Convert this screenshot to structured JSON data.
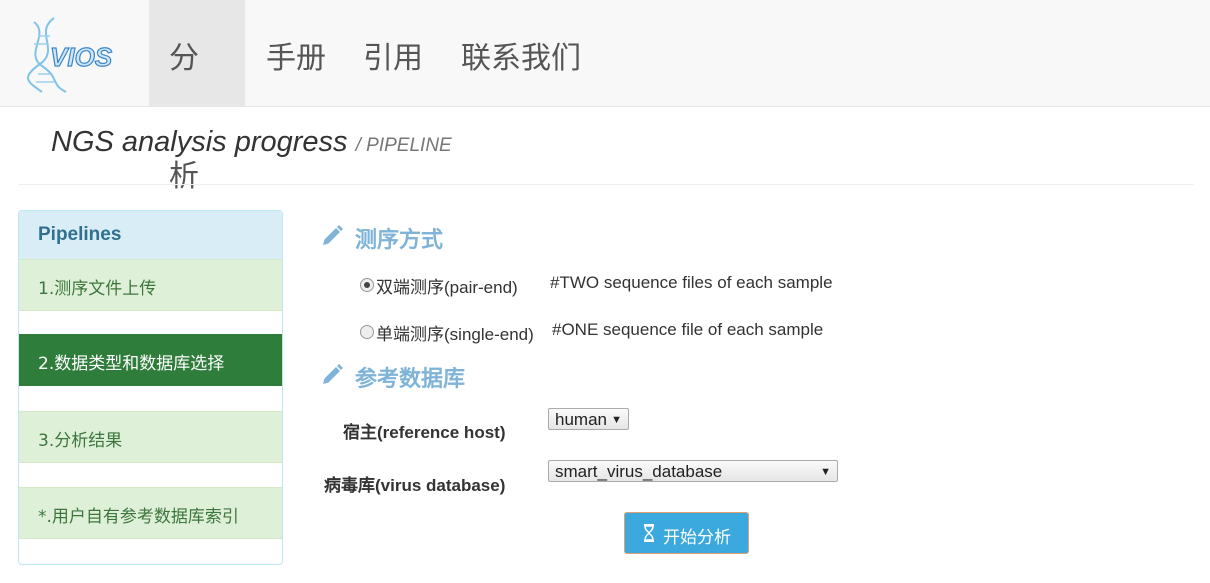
{
  "brand": {
    "logo_text": "VIOS"
  },
  "nav": {
    "items": [
      "分析",
      "手册",
      "引用",
      "联系我们"
    ]
  },
  "header": {
    "title": "NGS analysis progress",
    "subtitle": "/ PIPELINE"
  },
  "sidebar": {
    "heading": "Pipelines",
    "items": [
      {
        "label": "1.测序文件上传",
        "active": false
      },
      {
        "label": "2.数据类型和数据库选择",
        "active": true
      },
      {
        "label": "3.分析结果",
        "active": false
      },
      {
        "label": "*.用户自有参考数据库索引",
        "active": false
      }
    ]
  },
  "sequencing": {
    "title": "测序方式",
    "options": [
      {
        "label": "双端测序(pair-end)",
        "desc": "#TWO sequence files of each sample",
        "checked": true
      },
      {
        "label": "单端测序(single-end)",
        "desc": "#ONE sequence file of each sample",
        "checked": false
      }
    ]
  },
  "reference": {
    "title": "参考数据库",
    "host_label": "宿主(reference host)",
    "host_value": "human",
    "virus_label": "病毒库(virus database)",
    "virus_value": "smart_virus_database"
  },
  "actions": {
    "start_label": "开始分析"
  },
  "colors": {
    "accent": "#3ba9dd",
    "active_green": "#2e7d3a",
    "section_blue": "#7fb4d8"
  }
}
